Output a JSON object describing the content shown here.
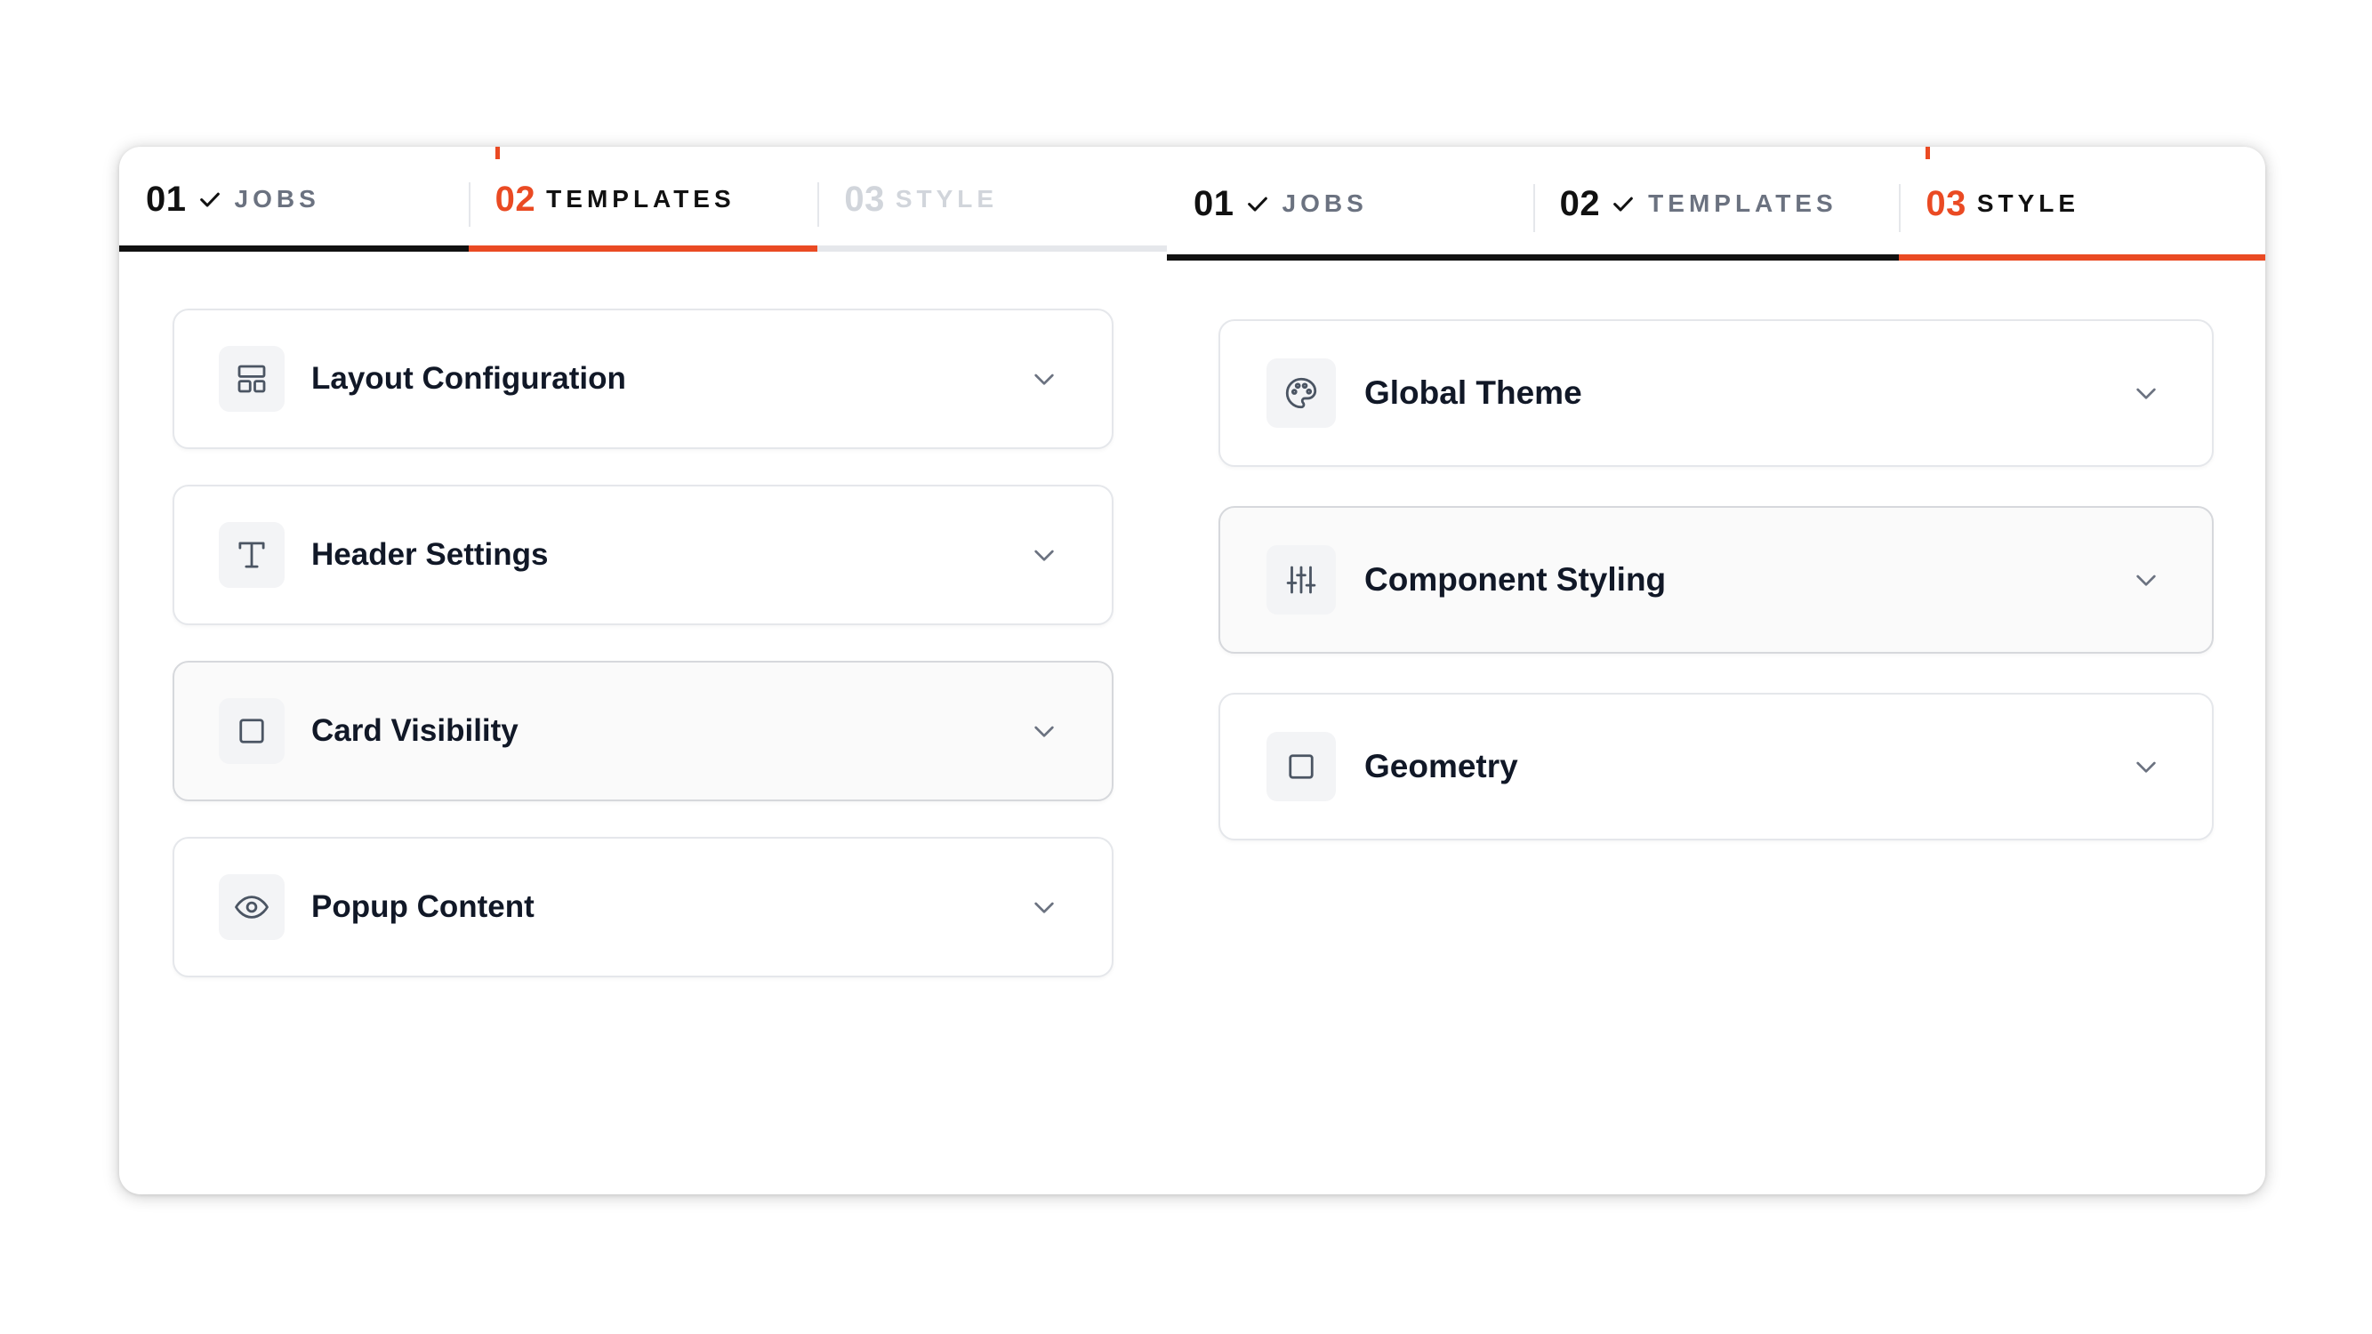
{
  "left_panel": {
    "steps": [
      {
        "number": "01",
        "label": "JOBS",
        "state": "done"
      },
      {
        "number": "02",
        "label": "TEMPLATES",
        "state": "active"
      },
      {
        "number": "03",
        "label": "STYLE",
        "state": "pending"
      }
    ],
    "cards": [
      {
        "title": "Layout Configuration",
        "icon": "layout-icon"
      },
      {
        "title": "Header Settings",
        "icon": "type-icon"
      },
      {
        "title": "Card Visibility",
        "icon": "square-icon"
      },
      {
        "title": "Popup Content",
        "icon": "eye-icon"
      }
    ]
  },
  "right_panel": {
    "steps": [
      {
        "number": "01",
        "label": "JOBS",
        "state": "done"
      },
      {
        "number": "02",
        "label": "TEMPLATES",
        "state": "done"
      },
      {
        "number": "03",
        "label": "STYLE",
        "state": "active"
      }
    ],
    "cards": [
      {
        "title": "Global Theme",
        "icon": "palette-icon"
      },
      {
        "title": "Component Styling",
        "icon": "sliders-icon"
      },
      {
        "title": "Geometry",
        "icon": "square-icon"
      }
    ]
  },
  "colors": {
    "accent": "#ea4a23",
    "text_primary": "#111827",
    "text_muted": "#6b7280",
    "pending": "#d1d5db",
    "border": "#e5e7eb"
  }
}
